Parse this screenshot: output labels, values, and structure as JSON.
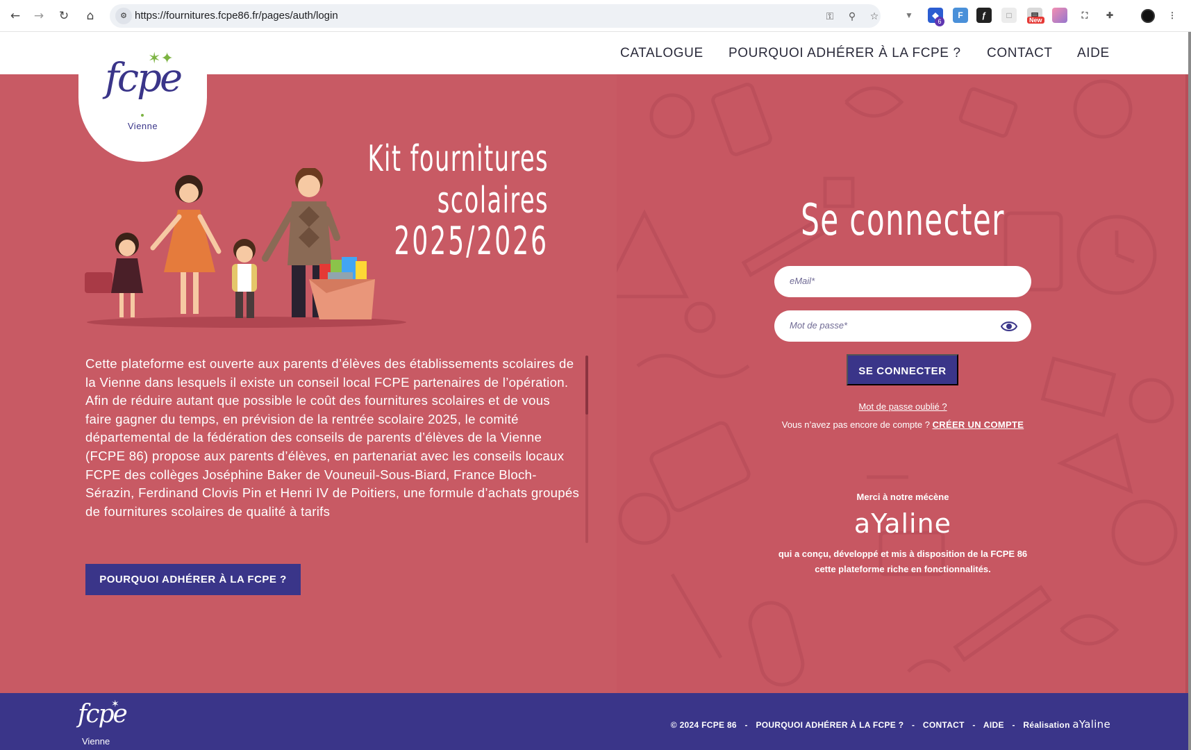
{
  "browser": {
    "url": "https://fournitures.fcpe86.fr/pages/auth/login",
    "back_glyph": "←",
    "forward_glyph": "→",
    "reload_glyph": "↻",
    "home_glyph": "⌂",
    "ext_badge_count": "6",
    "ext_badge_new": "New"
  },
  "header": {
    "logo_text": "fcpe",
    "logo_city": "Vienne",
    "nav": [
      "CATALOGUE",
      "POURQUOI ADHÉRER À LA FCPE ?",
      "CONTACT",
      "AIDE"
    ]
  },
  "hero": {
    "title_line1": "Kit fournitures scolaires",
    "title_line2": "2025/2026",
    "description": "Cette plateforme est ouverte aux parents d’élèves des établissements scolaires de la Vienne dans lesquels il existe un conseil local FCPE partenaires de l’opération.\nAfin de réduire autant que possible le coût des fournitures scolaires et de vous faire gagner du temps, en prévision de la rentrée scolaire 2025, le comité départemental de la fédération des conseils de parents d’élèves de la Vienne (FCPE 86) propose aux parents d’élèves, en partenariat avec les conseils locaux FCPE des collèges Joséphine Baker de Vouneuil-Sous-Biard, France Bloch-Sérazin, Ferdinand Clovis Pin et Henri IV de Poitiers, une formule d’achats groupés de fournitures scolaires de qualité à tarifs",
    "cta_label": "POURQUOI ADHÉRER À LA FCPE ?"
  },
  "login": {
    "title": "Se connecter",
    "email_placeholder": "eMail*",
    "password_placeholder": "Mot de passe*",
    "submit_label": "SE CONNECTER",
    "forgot_label": "Mot de passe oublié ?",
    "no_account_text": "Vous n’avez pas encore de compte ? ",
    "create_account_label": "CRÉER UN COMPTE"
  },
  "sponsor": {
    "label": "Merci à notre mécène",
    "name": "aYaline",
    "text": "qui a conçu, développé et mis à disposition de la FCPE 86 cette plateforme riche en fonctionnalités."
  },
  "footer": {
    "logo_text": "fcpe",
    "logo_city": "Vienne",
    "copyright": "© 2024 FCPE 86",
    "links": [
      "POURQUOI ADHÉRER À LA FCPE ?",
      "CONTACT",
      "AIDE"
    ],
    "separator": "-",
    "credit_label": "Réalisation",
    "credit_name": "aYaline"
  },
  "colors": {
    "primary": "#3a3589",
    "background": "#c85a64",
    "accent_green": "#7cb342"
  },
  "icons": [
    "back-icon",
    "forward-icon",
    "reload-icon",
    "home-icon",
    "site-info-icon",
    "password-key-icon",
    "zoom-icon",
    "bookmark-star-icon",
    "extensions-icon",
    "profile-avatar",
    "menu-dots-icon",
    "eye-icon"
  ]
}
